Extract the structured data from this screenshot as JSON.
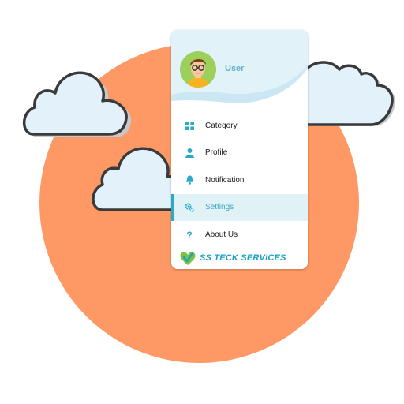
{
  "drawer": {
    "user_name": "User",
    "menu": [
      {
        "label": "Category",
        "icon": "grid-icon"
      },
      {
        "label": "Profile",
        "icon": "person-icon"
      },
      {
        "label": "Notification",
        "icon": "bell-icon"
      },
      {
        "label": "Settings",
        "icon": "gear-icon",
        "active": true
      },
      {
        "label": "About Us",
        "icon": "question-icon"
      }
    ],
    "brand": {
      "part1": "SS TECK",
      "part2": "SERVICES"
    }
  },
  "colors": {
    "circle": "#fe9965",
    "cloud_fill": "#e3f1fa",
    "cloud_outline": "#3a3a3a",
    "accent": "#2aa9c9",
    "active_bg": "#e1f2f6",
    "header_wave": "#dff0f7"
  }
}
